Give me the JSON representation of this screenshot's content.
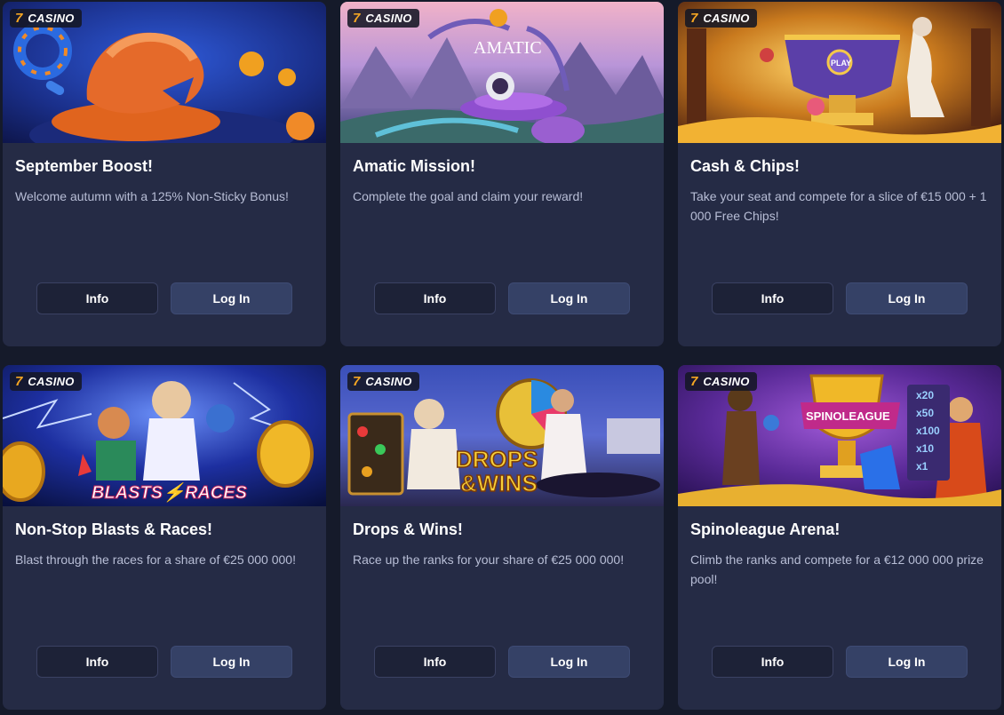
{
  "badge": {
    "seven": "7",
    "label": "CASINO"
  },
  "buttons": {
    "info": "Info",
    "login": "Log In"
  },
  "cards": [
    {
      "title": "September Boost!",
      "description": "Welcome autumn with a 125% Non-Sticky Bonus!",
      "banner_icon": "autumn-boost-illustration"
    },
    {
      "title": "Amatic Mission!",
      "description": "Complete the goal and claim your reward!",
      "banner_icon": "amatic-astronaut-illustration",
      "banner_text": "AMATIC"
    },
    {
      "title": "Cash & Chips!",
      "description": "Take your seat and compete for a slice of €15 000 + 1 000 Free Chips!",
      "banner_icon": "zeus-trophy-illustration",
      "banner_text": "PLAY"
    },
    {
      "title": "Non-Stop Blasts & Races!",
      "description": "Blast through the races for a share of €25 000 000!",
      "banner_icon": "blasts-races-illustration",
      "banner_text": "BLASTS RACES"
    },
    {
      "title": "Drops & Wins!",
      "description": "Race up the ranks for your share of €25 000 000!",
      "banner_icon": "drops-wins-illustration",
      "banner_text": "DROPS & WINS"
    },
    {
      "title": "Spinoleague Arena!",
      "description": "Climb the ranks and compete for a €12 000 000 prize pool!",
      "banner_icon": "spinoleague-trophy-illustration",
      "banner_text": "SPINOLEAGUE",
      "multipliers": [
        "x20",
        "x50",
        "x100",
        "x10",
        "x1"
      ]
    }
  ],
  "colors": {
    "page_bg": "#151a2a",
    "card_bg": "#252b45",
    "badge_seven": "#f5a623",
    "login_bg": "#354166"
  }
}
